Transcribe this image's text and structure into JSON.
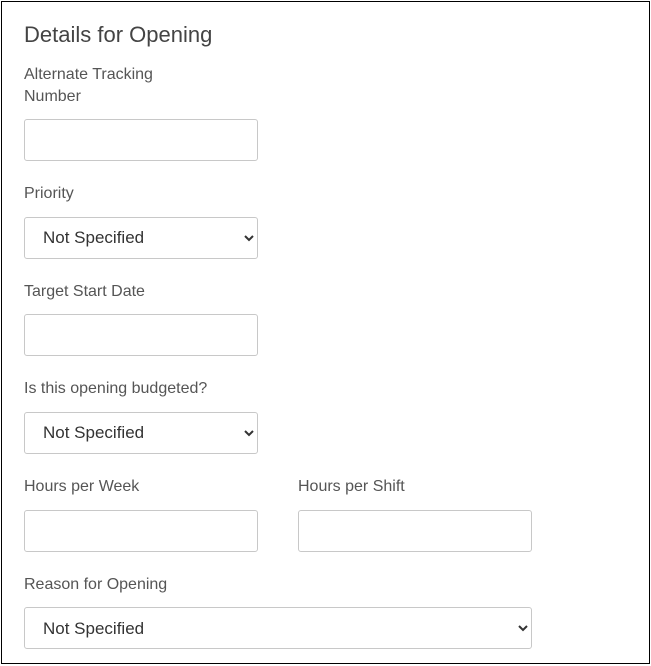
{
  "section": {
    "title": "Details for Opening"
  },
  "fields": {
    "alternate_tracking": {
      "label": "Alternate Tracking Number",
      "value": ""
    },
    "priority": {
      "label": "Priority",
      "selected": "Not Specified"
    },
    "target_start_date": {
      "label": "Target Start Date",
      "value": ""
    },
    "budgeted": {
      "label": "Is this opening budgeted?",
      "selected": "Not Specified"
    },
    "hours_per_week": {
      "label": "Hours per Week",
      "value": ""
    },
    "hours_per_shift": {
      "label": "Hours per Shift",
      "value": ""
    },
    "reason_for_opening": {
      "label": "Reason for Opening",
      "selected": "Not Specified"
    }
  }
}
